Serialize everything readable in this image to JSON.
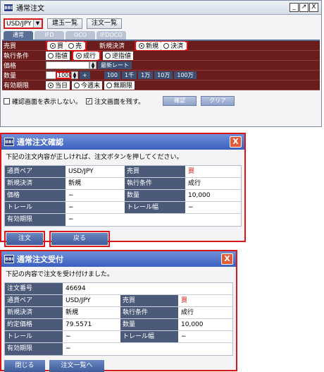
{
  "order_window": {
    "title": "通常注文",
    "icon_label": "BBI",
    "controls": {
      "minimize": "_",
      "restore": "↗",
      "close": "X"
    },
    "currency_value": "USD/JPY",
    "buttons": {
      "positions": "建玉一覧",
      "orders": "注文一覧"
    },
    "tabs": [
      "通常",
      "IFD",
      "OCO",
      "IFDOCO"
    ],
    "rows": {
      "buysell_label": "売買",
      "buy": "買",
      "sell": "売",
      "newclose_label": "新規決済",
      "new": "新規",
      "close": "決済",
      "condition_label": "執行条件",
      "limit": "指値",
      "market": "成行",
      "stop": "逆指値",
      "price_label": "価格",
      "latest_rate": "最新レート",
      "qty_label": "数量",
      "qty_value": "10000",
      "qty_plus": "+",
      "qty_presets": [
        "100",
        "1千",
        "1万",
        "10万",
        "100万"
      ],
      "expiry_label": "有効期限",
      "today": "当日",
      "this_week": "今週末",
      "indefinite": "無期限"
    },
    "options": {
      "no_confirm": "確認画面を表示しない。",
      "keep_screen": "注文画面を残す。",
      "keep_check": "✓"
    },
    "action_buttons": {
      "confirm": "確認",
      "clear": "クリア"
    }
  },
  "confirm_window": {
    "title": "通常注文確認",
    "icon_label": "BBI",
    "close": "X",
    "message": "下記の注文内容が正しければ、注文ボタンを押してください。",
    "rows": [
      {
        "l1": "通貨ペア",
        "v1": "USD/JPY",
        "l2": "売買",
        "v2": "買"
      },
      {
        "l1": "新規決済",
        "v1": "新規",
        "l2": "執行条件",
        "v2": "成行"
      },
      {
        "l1": "価格",
        "v1": "−",
        "l2": "数量",
        "v2": "10,000"
      },
      {
        "l1": "トレール",
        "v1": "−",
        "l2": "トレール幅",
        "v2": "−"
      }
    ],
    "expiry_row": {
      "l1": "有効期限",
      "v1": "−"
    },
    "buttons": {
      "order": "注文",
      "back": "戻る"
    }
  },
  "receipt_window": {
    "title": "通常注文受付",
    "icon_label": "BBI",
    "close": "X",
    "message": "下記の内容で注文を受け付けました。",
    "order_no_row": {
      "l1": "注文番号",
      "v1": "46694"
    },
    "rows": [
      {
        "l1": "通貨ペア",
        "v1": "USD/JPY",
        "l2": "売買",
        "v2": "買"
      },
      {
        "l1": "新規決済",
        "v1": "新規",
        "l2": "執行条件",
        "v2": "成行"
      },
      {
        "l1": "約定価格",
        "v1": "79.5571",
        "l2": "数量",
        "v2": "10,000"
      },
      {
        "l1": "トレール",
        "v1": "−",
        "l2": "トレール幅",
        "v2": "−"
      }
    ],
    "expiry_row": {
      "l1": "有効期限",
      "v1": "−"
    },
    "buttons": {
      "close": "閉じる",
      "order_list": "注文一覧へ"
    }
  }
}
